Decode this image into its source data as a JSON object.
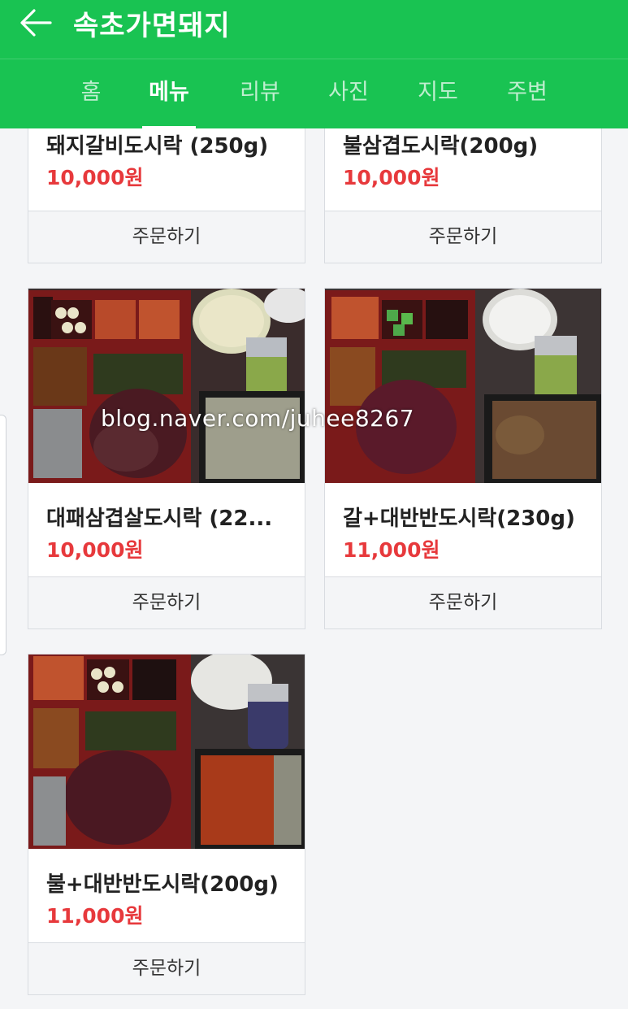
{
  "header": {
    "title": "속초가면돼지",
    "back_icon": "arrow-left-icon",
    "color": "#19c352"
  },
  "tabs": [
    {
      "label": "홈"
    },
    {
      "label": "메뉴",
      "active": true
    },
    {
      "label": "리뷰"
    },
    {
      "label": "사진"
    },
    {
      "label": "지도"
    },
    {
      "label": "주변"
    }
  ],
  "menu": [
    {
      "name": "돼지갈비도시락 (250g)",
      "price": "10,000원",
      "button": "주문하기"
    },
    {
      "name": "불삼겹도시락(200g)",
      "price": "10,000원",
      "button": "주문하기"
    },
    {
      "name": "대패삼겹살도시락 (22...",
      "price": "10,000원",
      "button": "주문하기"
    },
    {
      "name": "갈+대반반도시락(230g)",
      "price": "11,000원",
      "button": "주문하기"
    },
    {
      "name": "불+대반반도시락(200g)",
      "price": "11,000원",
      "button": "주문하기"
    }
  ],
  "watermark": "blog.naver.com/juhee8267",
  "price_color": "#e7393c"
}
